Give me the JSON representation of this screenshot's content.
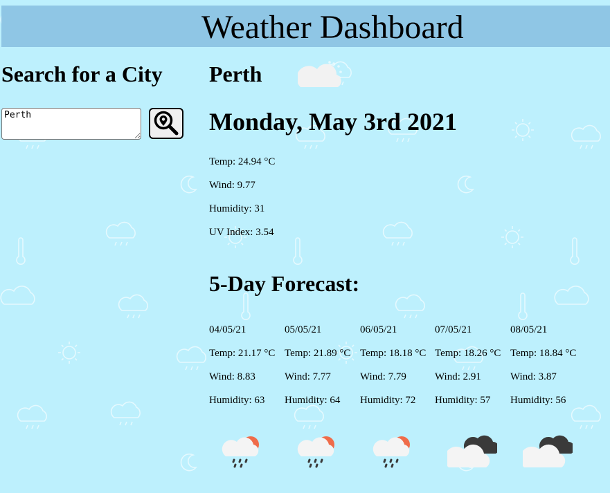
{
  "header": {
    "title": "Weather Dashboard"
  },
  "search": {
    "title": "Search for a City",
    "input_value": "Perth",
    "button_icon": "location-search-icon"
  },
  "current": {
    "city": "Perth",
    "icon": "partly-cloudy-icon",
    "date": "Monday, May 3rd 2021",
    "temp": "Temp: 24.94 °C",
    "wind": "Wind: 9.77",
    "humidity": "Humidity: 31",
    "uv": "UV Index: 3.54"
  },
  "forecast": {
    "title": "5-Day Forecast:",
    "days": [
      {
        "date": "04/05/21",
        "temp": "Temp: 21.17 °C",
        "wind": "Wind: 8.83",
        "humidity": "Humidity: 63",
        "icon": "sun-cloud-rain-icon"
      },
      {
        "date": "05/05/21",
        "temp": "Temp: 21.89 °C",
        "wind": "Wind: 7.77",
        "humidity": "Humidity: 64",
        "icon": "sun-cloud-rain-icon"
      },
      {
        "date": "06/05/21",
        "temp": "Temp: 18.18 °C",
        "wind": "Wind: 7.79",
        "humidity": "Humidity: 72",
        "icon": "sun-cloud-rain-icon"
      },
      {
        "date": "07/05/21",
        "temp": "Temp: 18.26 °C",
        "wind": "Wind: 2.91",
        "humidity": "Humidity: 57",
        "icon": "broken-clouds-icon"
      },
      {
        "date": "08/05/21",
        "temp": "Temp: 18.84 °C",
        "wind": "Wind: 3.87",
        "humidity": "Humidity: 56",
        "icon": "broken-clouds-icon"
      }
    ]
  },
  "colors": {
    "background": "#bdf0fd",
    "header_background": "#8fc6e5",
    "sun_accent": "#ef6c4a",
    "dark_cloud": "#3a3a3a",
    "light_cloud": "#f4f4f4"
  }
}
